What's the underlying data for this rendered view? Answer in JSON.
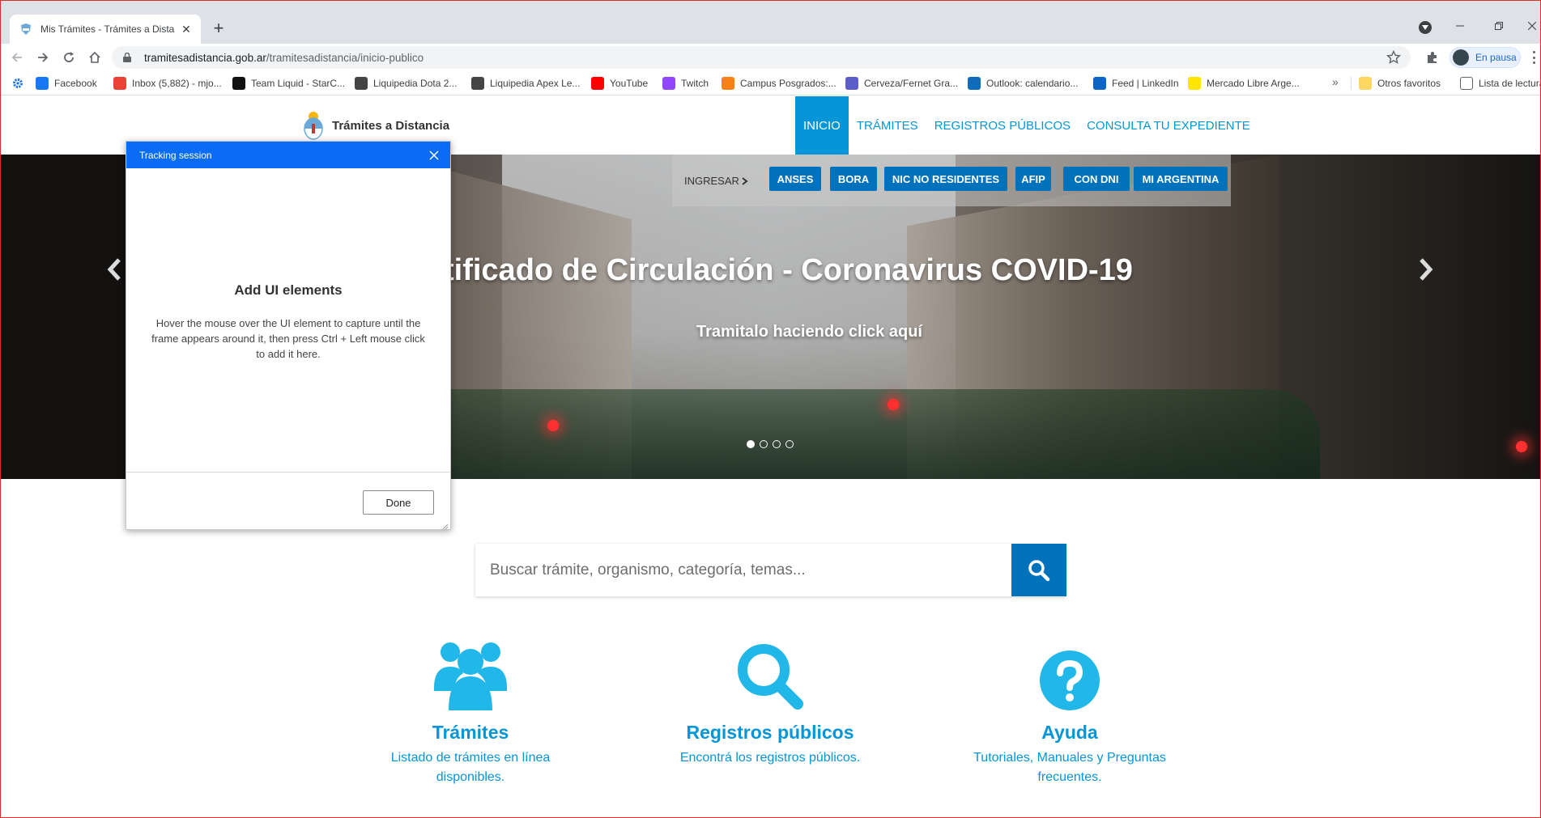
{
  "browser": {
    "tab_title": "Mis Trámites - Trámites a Distancia",
    "url_host": "tramitesadistancia.gob.ar",
    "url_path": "/tramitesadistancia/inicio-publico",
    "profile_label": "En pausa",
    "bookmarks": [
      {
        "label": "Facebook",
        "icon": "facebook-icon",
        "color": "#1877f2"
      },
      {
        "label": "Inbox (5,882) - mjo...",
        "icon": "gmail-icon",
        "color": "#ea4335"
      },
      {
        "label": "Team Liquid - StarC...",
        "icon": "teamliquid-icon",
        "color": "#111111"
      },
      {
        "label": "Liquipedia Dota 2...",
        "icon": "liquipedia-icon",
        "color": "#444444"
      },
      {
        "label": "Liquipedia Apex Le...",
        "icon": "liquipedia-icon",
        "color": "#444444"
      },
      {
        "label": "YouTube",
        "icon": "youtube-icon",
        "color": "#ff0000"
      },
      {
        "label": "Twitch",
        "icon": "twitch-icon",
        "color": "#9146ff"
      },
      {
        "label": "Campus Posgrados:...",
        "icon": "moodle-icon",
        "color": "#f98012"
      },
      {
        "label": "Cerveza/Fernet Gra...",
        "icon": "teams-icon",
        "color": "#5b5fc7"
      },
      {
        "label": "Outlook: calendario...",
        "icon": "outlook-icon",
        "color": "#0f6cbd"
      },
      {
        "label": "Feed | LinkedIn",
        "icon": "linkedin-icon",
        "color": "#0a66c2"
      },
      {
        "label": "Mercado Libre Arge...",
        "icon": "mercadolibre-icon",
        "color": "#ffe600"
      }
    ],
    "other_bookmarks": "Otros favoritos",
    "reading_list": "Lista de lectura"
  },
  "site": {
    "brand": "Trámites a Distancia",
    "nav": [
      {
        "label": "INICIO",
        "active": true
      },
      {
        "label": "TRÁMITES",
        "active": false
      },
      {
        "label": "REGISTROS PÚBLICOS",
        "active": false
      },
      {
        "label": "CONSULTA TU EXPEDIENTE",
        "active": false
      }
    ],
    "login_label": "INGRESAR",
    "login_options": [
      "ANSES",
      "BORA",
      "NIC NO RESIDENTES",
      "AFIP",
      "CON DNI",
      "MI ARGENTINA"
    ],
    "hero_title": "tificado de Circulación - Coronavirus COVID-19",
    "hero_subtitle": "Tramitalo haciendo click aquí",
    "carousel_slides": 4,
    "carousel_active": 1,
    "search_placeholder": "Buscar trámite, organismo, categoría, temas...",
    "features": [
      {
        "title": "Trámites",
        "desc": "Listado de trámites en línea disponibles.",
        "icon": "users-icon"
      },
      {
        "title": "Registros públicos",
        "desc": "Encontrá los registros públicos.",
        "icon": "search-icon"
      },
      {
        "title": "Ayuda",
        "desc": "Tutoriales, Manuales y Preguntas frecuentes.",
        "icon": "help-icon"
      }
    ],
    "accent_color": "#0695d6",
    "button_color": "#0072bb"
  },
  "dialog": {
    "title": "Tracking session",
    "heading": "Add UI elements",
    "text": "Hover the mouse over the UI element to capture until the frame appears around it, then press Ctrl + Left mouse click to add it here.",
    "done_label": "Done",
    "titlebar_color": "#0a6cf5"
  }
}
